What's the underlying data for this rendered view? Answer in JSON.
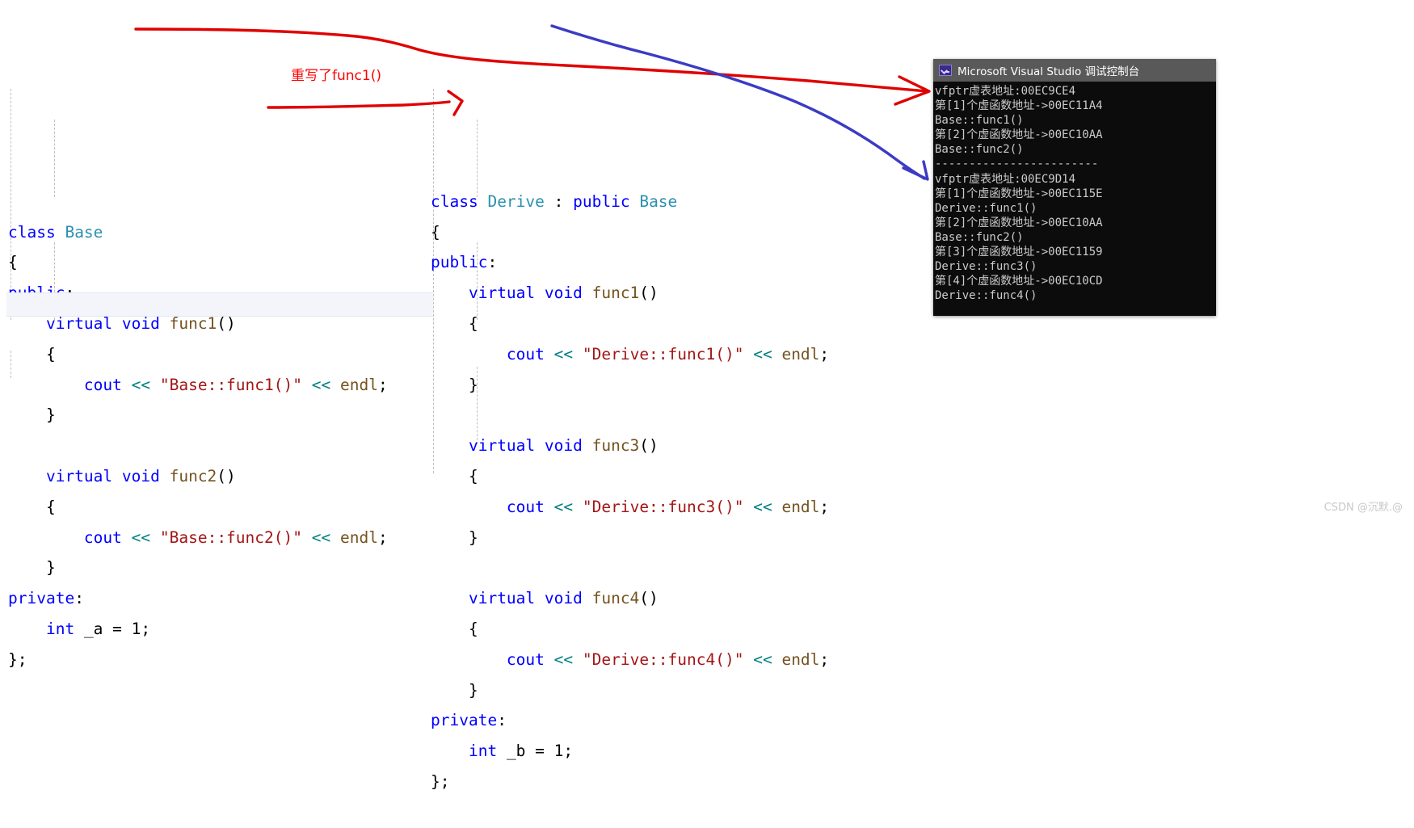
{
  "editor": {
    "base_class": {
      "name": "base-class-code",
      "lines": [
        [
          {
            "t": "class ",
            "c": "k"
          },
          {
            "t": "Base",
            "c": "typ"
          }
        ],
        [
          {
            "t": "{",
            "c": "pl"
          }
        ],
        [
          {
            "t": "public",
            "c": "k"
          },
          {
            "t": ":",
            "c": "pl"
          }
        ],
        [
          {
            "t": "    ",
            "c": "pl"
          },
          {
            "t": "virtual void ",
            "c": "k"
          },
          {
            "t": "func1",
            "c": "fn"
          },
          {
            "t": "()",
            "c": "pl"
          }
        ],
        [
          {
            "t": "    {",
            "c": "pl"
          }
        ],
        [
          {
            "t": "        ",
            "c": "pl"
          },
          {
            "t": "cout",
            "c": "k"
          },
          {
            "t": " ",
            "c": "pl"
          },
          {
            "t": "<<",
            "c": "op"
          },
          {
            "t": " ",
            "c": "pl"
          },
          {
            "t": "\"Base::func1()\"",
            "c": "str"
          },
          {
            "t": " ",
            "c": "pl"
          },
          {
            "t": "<<",
            "c": "op"
          },
          {
            "t": " ",
            "c": "pl"
          },
          {
            "t": "endl",
            "c": "fn"
          },
          {
            "t": ";",
            "c": "pl"
          }
        ],
        [
          {
            "t": "    }",
            "c": "pl"
          }
        ],
        [
          {
            "t": "",
            "c": "pl"
          }
        ],
        [
          {
            "t": "    ",
            "c": "pl"
          },
          {
            "t": "virtual void ",
            "c": "k"
          },
          {
            "t": "func2",
            "c": "fn"
          },
          {
            "t": "()",
            "c": "pl"
          }
        ],
        [
          {
            "t": "    {",
            "c": "pl"
          }
        ],
        [
          {
            "t": "        ",
            "c": "pl"
          },
          {
            "t": "cout",
            "c": "k"
          },
          {
            "t": " ",
            "c": "pl"
          },
          {
            "t": "<<",
            "c": "op"
          },
          {
            "t": " ",
            "c": "pl"
          },
          {
            "t": "\"Base::func2()\"",
            "c": "str"
          },
          {
            "t": " ",
            "c": "pl"
          },
          {
            "t": "<<",
            "c": "op"
          },
          {
            "t": " ",
            "c": "pl"
          },
          {
            "t": "endl",
            "c": "fn"
          },
          {
            "t": ";",
            "c": "pl"
          }
        ],
        [
          {
            "t": "    }",
            "c": "pl"
          }
        ],
        [
          {
            "t": "private",
            "c": "k"
          },
          {
            "t": ":",
            "c": "pl"
          }
        ],
        [
          {
            "t": "    ",
            "c": "pl"
          },
          {
            "t": "int",
            "c": "k"
          },
          {
            "t": " _a = ",
            "c": "pl"
          },
          {
            "t": "1",
            "c": "pl"
          },
          {
            "t": ";",
            "c": "pl"
          }
        ],
        [
          {
            "t": "};",
            "c": "pl"
          }
        ]
      ]
    },
    "derive_class": {
      "name": "derive-class-code",
      "lines": [
        [
          {
            "t": "class ",
            "c": "k"
          },
          {
            "t": "Derive",
            "c": "typ"
          },
          {
            "t": " : ",
            "c": "pl"
          },
          {
            "t": "public ",
            "c": "k"
          },
          {
            "t": "Base",
            "c": "typ"
          }
        ],
        [
          {
            "t": "{",
            "c": "pl"
          }
        ],
        [
          {
            "t": "public",
            "c": "k"
          },
          {
            "t": ":",
            "c": "pl"
          }
        ],
        [
          {
            "t": "    ",
            "c": "pl"
          },
          {
            "t": "virtual void ",
            "c": "k"
          },
          {
            "t": "func1",
            "c": "fn"
          },
          {
            "t": "()",
            "c": "pl"
          }
        ],
        [
          {
            "t": "    {",
            "c": "pl"
          }
        ],
        [
          {
            "t": "        ",
            "c": "pl"
          },
          {
            "t": "cout",
            "c": "k"
          },
          {
            "t": " ",
            "c": "pl"
          },
          {
            "t": "<<",
            "c": "op"
          },
          {
            "t": " ",
            "c": "pl"
          },
          {
            "t": "\"Derive::func1()\"",
            "c": "str"
          },
          {
            "t": " ",
            "c": "pl"
          },
          {
            "t": "<<",
            "c": "op"
          },
          {
            "t": " ",
            "c": "pl"
          },
          {
            "t": "endl",
            "c": "fn"
          },
          {
            "t": ";",
            "c": "pl"
          }
        ],
        [
          {
            "t": "    }",
            "c": "pl"
          }
        ],
        [
          {
            "t": "",
            "c": "pl"
          }
        ],
        [
          {
            "t": "    ",
            "c": "pl"
          },
          {
            "t": "virtual void ",
            "c": "k"
          },
          {
            "t": "func3",
            "c": "fn"
          },
          {
            "t": "()",
            "c": "pl"
          }
        ],
        [
          {
            "t": "    {",
            "c": "pl"
          }
        ],
        [
          {
            "t": "        ",
            "c": "pl"
          },
          {
            "t": "cout",
            "c": "k"
          },
          {
            "t": " ",
            "c": "pl"
          },
          {
            "t": "<<",
            "c": "op"
          },
          {
            "t": " ",
            "c": "pl"
          },
          {
            "t": "\"Derive::func3()\"",
            "c": "str"
          },
          {
            "t": " ",
            "c": "pl"
          },
          {
            "t": "<<",
            "c": "op"
          },
          {
            "t": " ",
            "c": "pl"
          },
          {
            "t": "endl",
            "c": "fn"
          },
          {
            "t": ";",
            "c": "pl"
          }
        ],
        [
          {
            "t": "    }",
            "c": "pl"
          }
        ],
        [
          {
            "t": "",
            "c": "pl"
          }
        ],
        [
          {
            "t": "    ",
            "c": "pl"
          },
          {
            "t": "virtual void ",
            "c": "k"
          },
          {
            "t": "func4",
            "c": "fn"
          },
          {
            "t": "()",
            "c": "pl"
          }
        ],
        [
          {
            "t": "    {",
            "c": "pl"
          }
        ],
        [
          {
            "t": "        ",
            "c": "pl"
          },
          {
            "t": "cout",
            "c": "k"
          },
          {
            "t": " ",
            "c": "pl"
          },
          {
            "t": "<<",
            "c": "op"
          },
          {
            "t": " ",
            "c": "pl"
          },
          {
            "t": "\"Derive::func4()\"",
            "c": "str"
          },
          {
            "t": " ",
            "c": "pl"
          },
          {
            "t": "<<",
            "c": "op"
          },
          {
            "t": " ",
            "c": "pl"
          },
          {
            "t": "endl",
            "c": "fn"
          },
          {
            "t": ";",
            "c": "pl"
          }
        ],
        [
          {
            "t": "    }",
            "c": "pl"
          }
        ],
        [
          {
            "t": "private",
            "c": "k"
          },
          {
            "t": ":",
            "c": "pl"
          }
        ],
        [
          {
            "t": "    ",
            "c": "pl"
          },
          {
            "t": "int",
            "c": "k"
          },
          {
            "t": " _b = ",
            "c": "pl"
          },
          {
            "t": "1",
            "c": "pl"
          },
          {
            "t": ";",
            "c": "pl"
          }
        ],
        [
          {
            "t": "};",
            "c": "pl"
          }
        ]
      ]
    }
  },
  "annotation": {
    "note_text": "重写了func1()",
    "note_color": "#ff0000",
    "red_arrow_color": "#e00000",
    "blue_arrow_color": "#3b3bc4"
  },
  "console": {
    "title": "Microsoft Visual Studio 调试控制台",
    "icon": "console-app-icon",
    "background": "#0c0c0c",
    "titlebar_background": "#595959",
    "text_color": "#cccccc",
    "lines": [
      "vfptr虚表地址:00EC9CE4",
      "第[1]个虚函数地址->00EC11A4",
      "Base::func1()",
      "第[2]个虚函数地址->00EC10AA",
      "Base::func2()",
      "------------------------",
      "vfptr虚表地址:00EC9D14",
      "第[1]个虚函数地址->00EC115E",
      "Derive::func1()",
      "第[2]个虚函数地址->00EC10AA",
      "Base::func2()",
      "第[3]个虚函数地址->00EC1159",
      "Derive::func3()",
      "第[4]个虚函数地址->00EC10CD",
      "Derive::func4()"
    ]
  },
  "watermark": {
    "text": "CSDN @沉默.@"
  }
}
